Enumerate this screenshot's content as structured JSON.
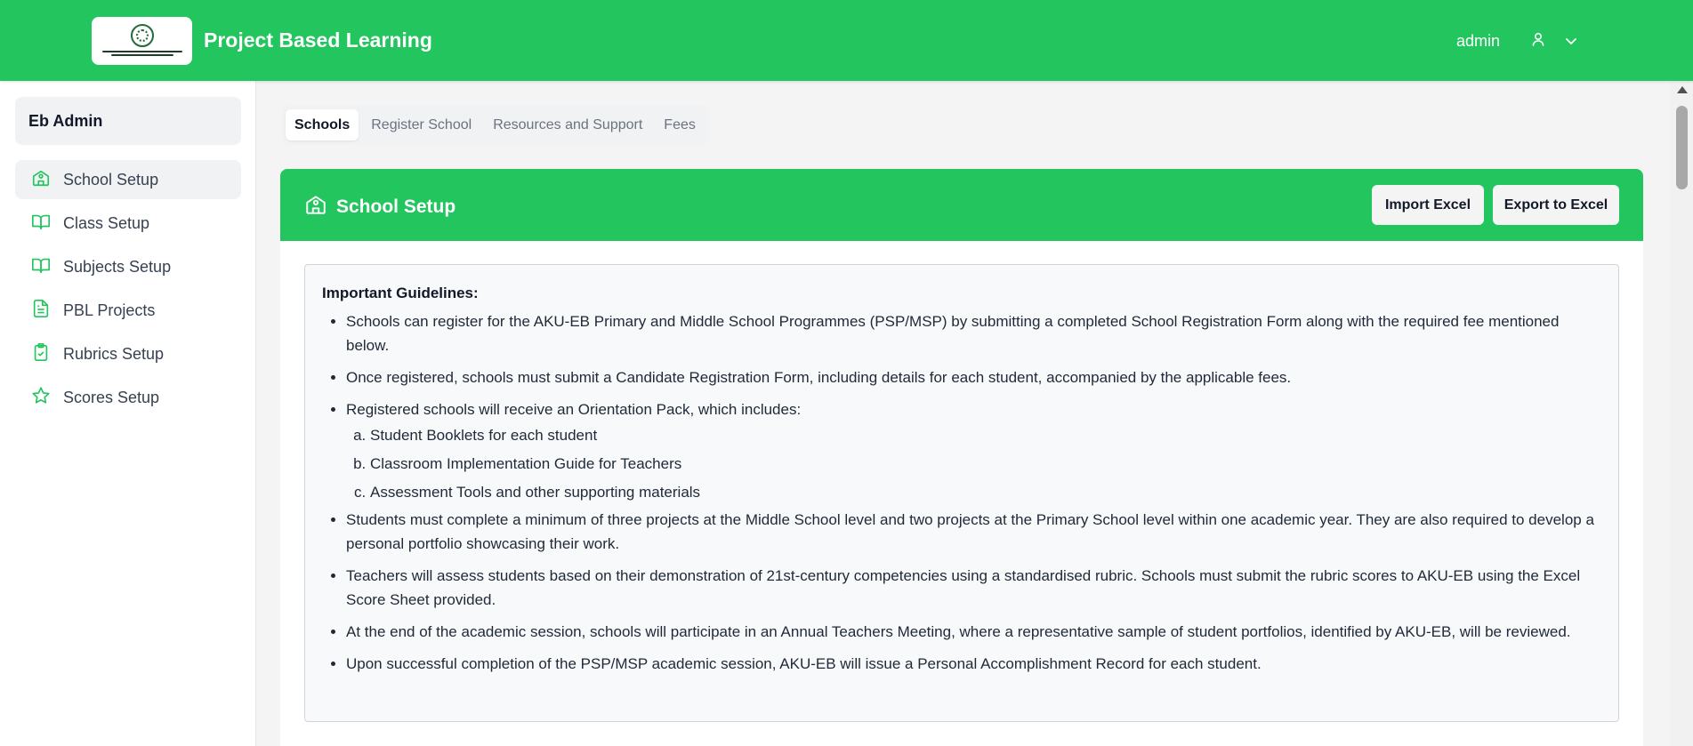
{
  "header": {
    "app_title": "Project Based Learning",
    "user_name": "admin",
    "logo_alt": "AKU-EB logo"
  },
  "sidebar": {
    "title": "Eb Admin",
    "items": [
      {
        "label": "School Setup",
        "icon": "school-icon",
        "active": true
      },
      {
        "label": "Class Setup",
        "icon": "book-icon"
      },
      {
        "label": "Subjects Setup",
        "icon": "book-icon"
      },
      {
        "label": "PBL Projects",
        "icon": "document-icon"
      },
      {
        "label": "Rubrics Setup",
        "icon": "clipboard-check-icon"
      },
      {
        "label": "Scores Setup",
        "icon": "star-icon"
      }
    ]
  },
  "tabs": [
    {
      "label": "Schools",
      "active": true
    },
    {
      "label": "Register School"
    },
    {
      "label": "Resources and Support"
    },
    {
      "label": "Fees"
    }
  ],
  "card": {
    "title": "School Setup",
    "import_label": "Import Excel",
    "export_label": "Export to Excel"
  },
  "guidelines": {
    "heading": "Important Guidelines:",
    "items": [
      "Schools can register for the AKU-EB Primary and Middle School Programmes (PSP/MSP) by submitting a completed School Registration Form along with the required fee mentioned below.",
      "Once registered, schools must submit a Candidate Registration Form, including details for each student, accompanied by the applicable fees.",
      "Registered schools will receive an Orientation Pack, which includes:",
      "Students must complete a minimum of three projects at the Middle School level and two projects at the Primary School level within one academic year. They are also required to develop a personal portfolio showcasing their work.",
      "Teachers will assess students based on their demonstration of 21st-century competencies using a standardised rubric. Schools must submit the rubric scores to AKU-EB using the Excel Score Sheet provided.",
      "At the end of the academic session, schools will participate in an Annual Teachers Meeting, where a representative sample of student portfolios, identified by AKU-EB, will be reviewed.",
      "Upon successful completion of the PSP/MSP academic session, AKU-EB will issue a Personal Accomplishment Record for each student."
    ],
    "orientation_pack": [
      "Student Booklets for each student",
      "Classroom Implementation Guide for Teachers",
      "Assessment Tools and other supporting materials"
    ]
  },
  "colors": {
    "brand_green": "#22c55e",
    "sidebar_active_bg": "#f1f2f4"
  }
}
